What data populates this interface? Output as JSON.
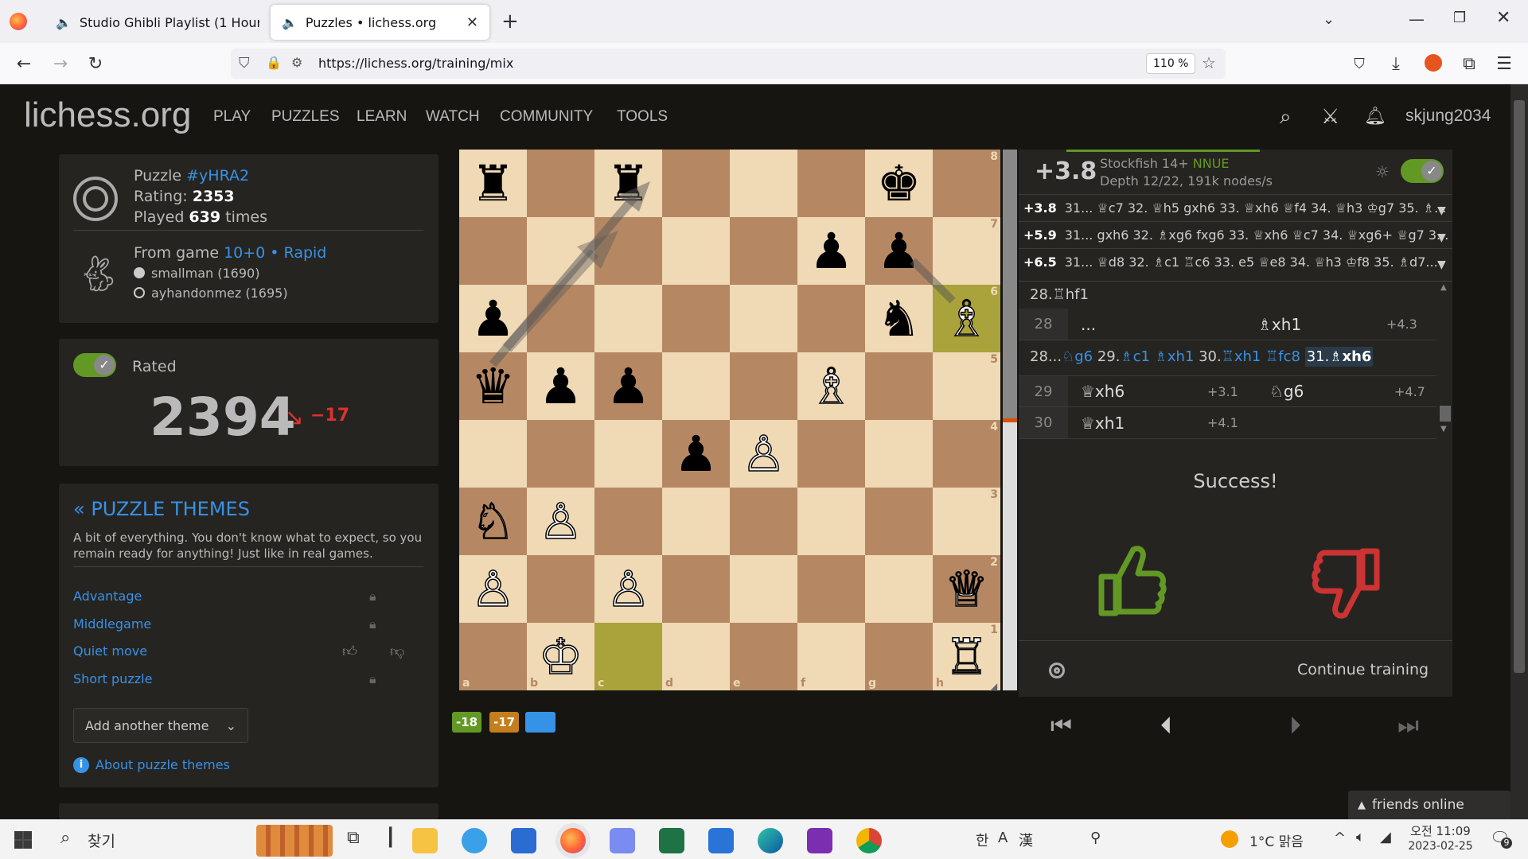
{
  "browser": {
    "tabs": [
      {
        "label": "Studio Ghibli Playlist (1 Hour o"
      },
      {
        "label": "Puzzles • lichess.org"
      }
    ],
    "url": "https://lichess.org/training/mix",
    "zoom": "110 %"
  },
  "header": {
    "logo": "lichess.org",
    "nav": [
      "PLAY",
      "PUZZLES",
      "LEARN",
      "WATCH",
      "COMMUNITY",
      "TOOLS"
    ],
    "username": "skjung2034"
  },
  "puzzle_info": {
    "title_prefix": "Puzzle",
    "puzzle_id": "#yHRA2",
    "rating_label": "Rating:",
    "rating": "2353",
    "played_prefix": "Played",
    "played_count": "639",
    "played_suffix": "times",
    "from_game_label": "From game",
    "game_link": "10+0 • Rapid",
    "white_player": "smallman (1690)",
    "black_player": "ayhandonmez (1695)"
  },
  "rating_box": {
    "rated_label": "Rated",
    "rating": "2394",
    "change": "−17"
  },
  "themes": {
    "title": "« PUZZLE THEMES",
    "description": "A bit of everything. You don't know what to expect, so you remain ready for anything! Just like in real games.",
    "items": [
      "Advantage",
      "Middlegame",
      "Quiet move",
      "Short puzzle"
    ],
    "add_theme": "Add another theme",
    "about": "About puzzle themes"
  },
  "board": {
    "files": [
      "a",
      "b",
      "c",
      "d",
      "e",
      "f",
      "g",
      "h"
    ],
    "ranks": [
      "8",
      "7",
      "6",
      "5",
      "4",
      "3",
      "2",
      "1"
    ]
  },
  "engine": {
    "eval": "+3.8",
    "name": "Stockfish 14+",
    "nnue": "NNUE",
    "depth": "Depth 12/22, 191k nodes/s",
    "lines": [
      {
        "eval": "+3.8",
        "moves": "31... ♕c7 32. ♕h5 gxh6 33. ♕xh6 ♕f4 34. ♕h3 ♔g7 35. ♗..."
      },
      {
        "eval": "+5.9",
        "moves": "31... gxh6 32. ♗xg6 fxg6 33. ♕xh6 ♕c7 34. ♕xg6+ ♕g7 3..."
      },
      {
        "eval": "+6.5",
        "moves": "31... ♕d8 32. ♗c1 ♖c6 33. e5 ♕e8 34. ♕h3 ♔f8 35. ♗d7..."
      }
    ]
  },
  "moves": {
    "prev": "28.♖hf1",
    "row28": {
      "num": "28",
      "white": "...",
      "black": "♗xh1",
      "black_eval": "+4.3"
    },
    "variation": [
      "28...",
      "♘g6",
      "29.",
      "♗c1",
      "♗xh1",
      "30.",
      "♖xh1",
      "♖fc8",
      "31.",
      "♗xh6"
    ],
    "row29": {
      "num": "29",
      "white": "♕xh6",
      "white_eval": "+3.1",
      "black": "♘g6",
      "black_eval": "+4.7"
    },
    "row30": {
      "num": "30",
      "white": "♕xh1",
      "white_eval": "+4.1"
    }
  },
  "feedback": {
    "status": "Success!",
    "continue": "Continue training"
  },
  "badges": [
    "-18",
    "-17"
  ],
  "friends": "friends online",
  "taskbar": {
    "search": "찾기",
    "weather": "1°C 맑음",
    "time": "오전 11:09",
    "date": "2023-02-25",
    "ime": "한",
    "notif_count": "9"
  }
}
